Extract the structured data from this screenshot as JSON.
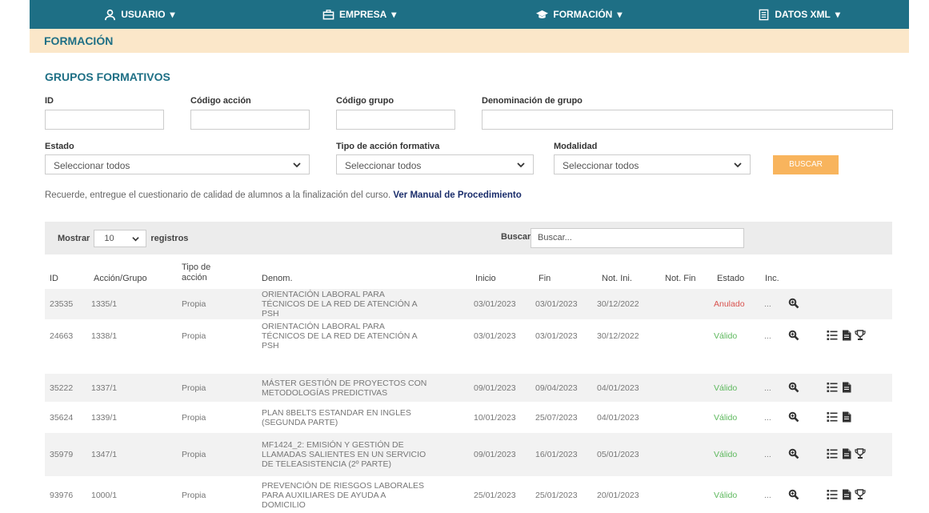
{
  "nav": {
    "usuario": "USUARIO",
    "empresa": "EMPRESA",
    "formacion": "FORMACIÓN",
    "datos_xml": "DATOS XML"
  },
  "band_title": "FORMACIÓN",
  "section_title": "GRUPOS FORMATIVOS",
  "filters": {
    "id_label": "ID",
    "codigo_accion_label": "Código acción",
    "codigo_grupo_label": "Código grupo",
    "denominacion_label": "Denominación de grupo",
    "estado_label": "Estado",
    "estado_value": "Seleccionar todos",
    "tipo_label": "Tipo de acción formativa",
    "tipo_value": "Seleccionar todos",
    "modalidad_label": "Modalidad",
    "modalidad_value": "Seleccionar todos",
    "buscar_button": "BUSCAR"
  },
  "notice": {
    "text": "Recuerde, entregue el cuestionario de calidad de alumnos a la finalización del curso.",
    "link": "Ver Manual de Procedimiento"
  },
  "table_controls": {
    "mostrar": "Mostrar",
    "length": "10",
    "registros": "registros",
    "buscar_label": "Buscar:",
    "search_placeholder": "Buscar..."
  },
  "columns": {
    "id": "ID",
    "accion": "Acción/Grupo",
    "tipo_line1": "Tipo de",
    "tipo_line2": "acción",
    "denom": "Denom.",
    "inicio": "Inicio",
    "fin": "Fin",
    "not_ini": "Not. Ini.",
    "not_fin": "Not. Fin",
    "estado": "Estado",
    "inc": "Inc."
  },
  "rows": [
    {
      "id": "23535",
      "accion": "1335/1",
      "tipo": "Propia",
      "denom": [
        "ORIENTACIÓN LABORAL PARA",
        "TÉCNICOS DE LA RED DE ATENCIÓN A",
        "PSH"
      ],
      "inicio": "03/01/2023",
      "fin": "03/01/2023",
      "not_ini": "30/12/2022",
      "estado": "Anulado",
      "inc": "...",
      "icons": [
        "search-icon"
      ]
    },
    {
      "id": "24663",
      "accion": "1338/1",
      "tipo": "Propia",
      "denom": [
        "ORIENTACIÓN LABORAL PARA",
        "TÉCNICOS DE LA RED DE ATENCIÓN A",
        "PSH"
      ],
      "inicio": "03/01/2023",
      "fin": "03/01/2023",
      "not_ini": "30/12/2022",
      "estado": "Válido",
      "inc": "...",
      "icons": [
        "search-icon",
        "list-icon",
        "document-icon",
        "trophy-icon"
      ]
    },
    {
      "id": "35222",
      "accion": "1337/1",
      "tipo": "Propia",
      "denom": [
        "MÁSTER GESTIÓN DE PROYECTOS CON",
        "METODOLOGÍAS PREDICTIVAS"
      ],
      "inicio": "09/01/2023",
      "fin": "09/04/2023",
      "not_ini": "04/01/2023",
      "estado": "Válido",
      "inc": "...",
      "icons": [
        "search-icon",
        "list-icon",
        "document-icon"
      ]
    },
    {
      "id": "35624",
      "accion": "1339/1",
      "tipo": "Propia",
      "denom": [
        "PLAN 8BELTS ESTANDAR EN INGLES",
        "(SEGUNDA PARTE)"
      ],
      "inicio": "10/01/2023",
      "fin": "25/07/2023",
      "not_ini": "04/01/2023",
      "estado": "Válido",
      "inc": "...",
      "icons": [
        "search-icon",
        "list-icon",
        "document-icon"
      ]
    },
    {
      "id": "35979",
      "accion": "1347/1",
      "tipo": "Propia",
      "denom": [
        "MF1424_2: EMISIÓN Y GESTIÓN DE",
        "LLAMADAS SALIENTES EN UN SERVICIO",
        "DE TELEASISTENCIA (2º PARTE)"
      ],
      "inicio": "09/01/2023",
      "fin": "16/01/2023",
      "not_ini": "05/01/2023",
      "estado": "Válido",
      "inc": "...",
      "icons": [
        "search-icon",
        "list-icon",
        "document-icon",
        "trophy-icon"
      ]
    },
    {
      "id": "93976",
      "accion": "1000/1",
      "tipo": "Propia",
      "denom": [
        "PREVENCIÓN DE RIESGOS LABORALES",
        "PARA AUXILIARES DE AYUDA A",
        "DOMICILIO"
      ],
      "inicio": "25/01/2023",
      "fin": "25/01/2023",
      "not_ini": "20/01/2023",
      "estado": "Válido",
      "inc": "...",
      "icons": [
        "search-icon",
        "list-icon",
        "document-icon",
        "trophy-icon"
      ]
    }
  ]
}
